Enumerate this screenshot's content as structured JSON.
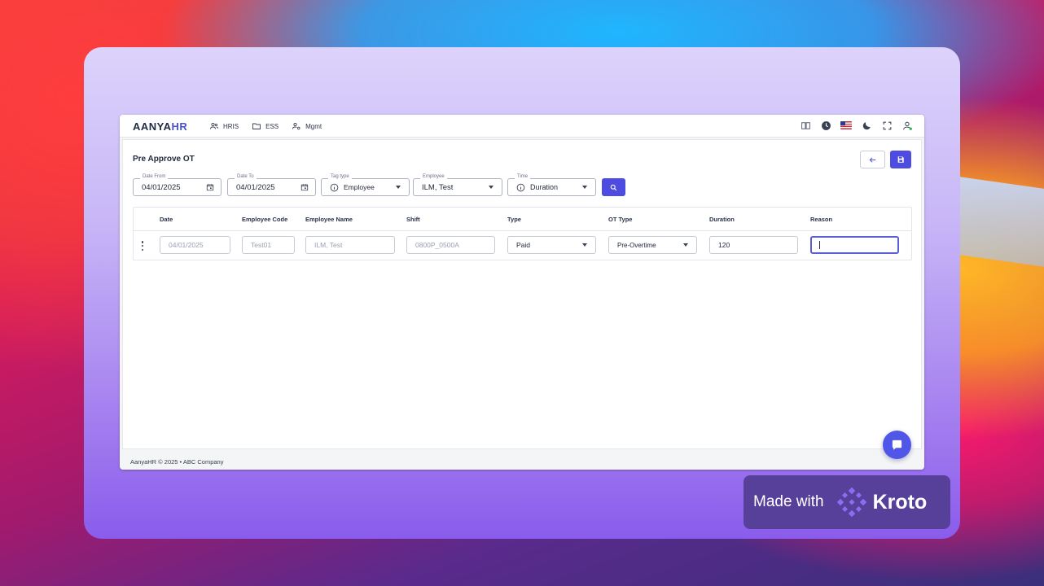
{
  "app": {
    "logo_main": "AANYA",
    "logo_accent": "HR",
    "nav": [
      {
        "label": "HRIS",
        "icon": "people-icon"
      },
      {
        "label": "ESS",
        "icon": "folder-icon"
      },
      {
        "label": "Mgmt",
        "icon": "user-gear-icon"
      }
    ]
  },
  "page": {
    "title": "Pre Approve OT"
  },
  "filters": {
    "date_from": {
      "label": "Date From",
      "value": "04/01/2025"
    },
    "date_to": {
      "label": "Date To",
      "value": "04/01/2025"
    },
    "tag_type": {
      "label": "Tag type",
      "value": "Employee"
    },
    "employee": {
      "label": "Employee",
      "value": "ILM, Test"
    },
    "time": {
      "label": "Time",
      "value": "Duration"
    }
  },
  "table": {
    "columns": [
      "Date",
      "Employee Code",
      "Employee Name",
      "Shift",
      "Type",
      "OT Type",
      "Duration",
      "Reason"
    ],
    "rows": [
      {
        "date": "04/01/2025",
        "employee_code": "Test01",
        "employee_name": "ILM, Test",
        "shift": "0800P_0500A",
        "type": "Paid",
        "ot_type": "Pre-Overtime",
        "duration": "120",
        "reason": ""
      }
    ]
  },
  "footer": {
    "text": "AanyaHR © 2025 • ABC Company"
  },
  "badge": {
    "made_with": "Made with",
    "brand": "Kroto"
  },
  "colors": {
    "primary": "#4e4ce0",
    "badge_bg": "#56409a"
  }
}
